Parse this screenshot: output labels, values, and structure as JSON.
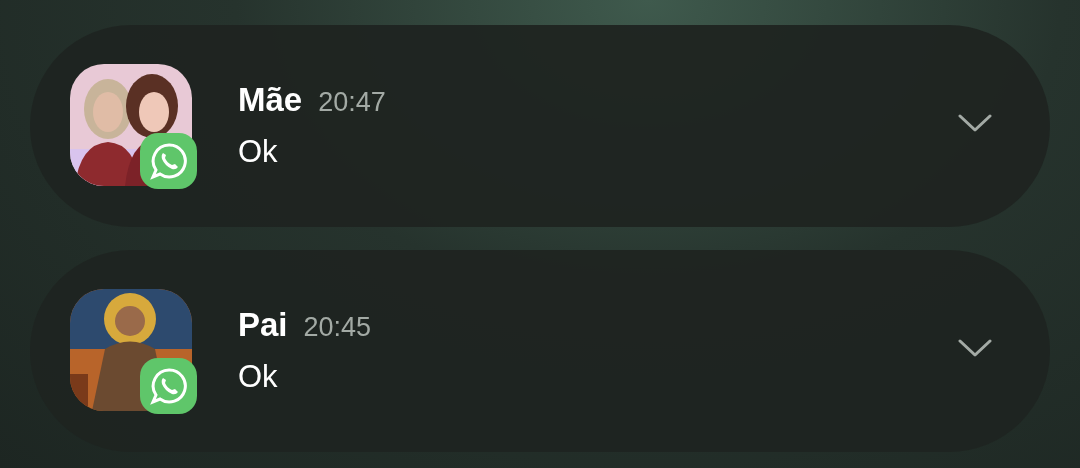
{
  "notifications": [
    {
      "name": "Mãe",
      "time": "20:47",
      "message": "Ok"
    },
    {
      "name": "Pai",
      "time": "20:45",
      "message": "Ok"
    }
  ]
}
